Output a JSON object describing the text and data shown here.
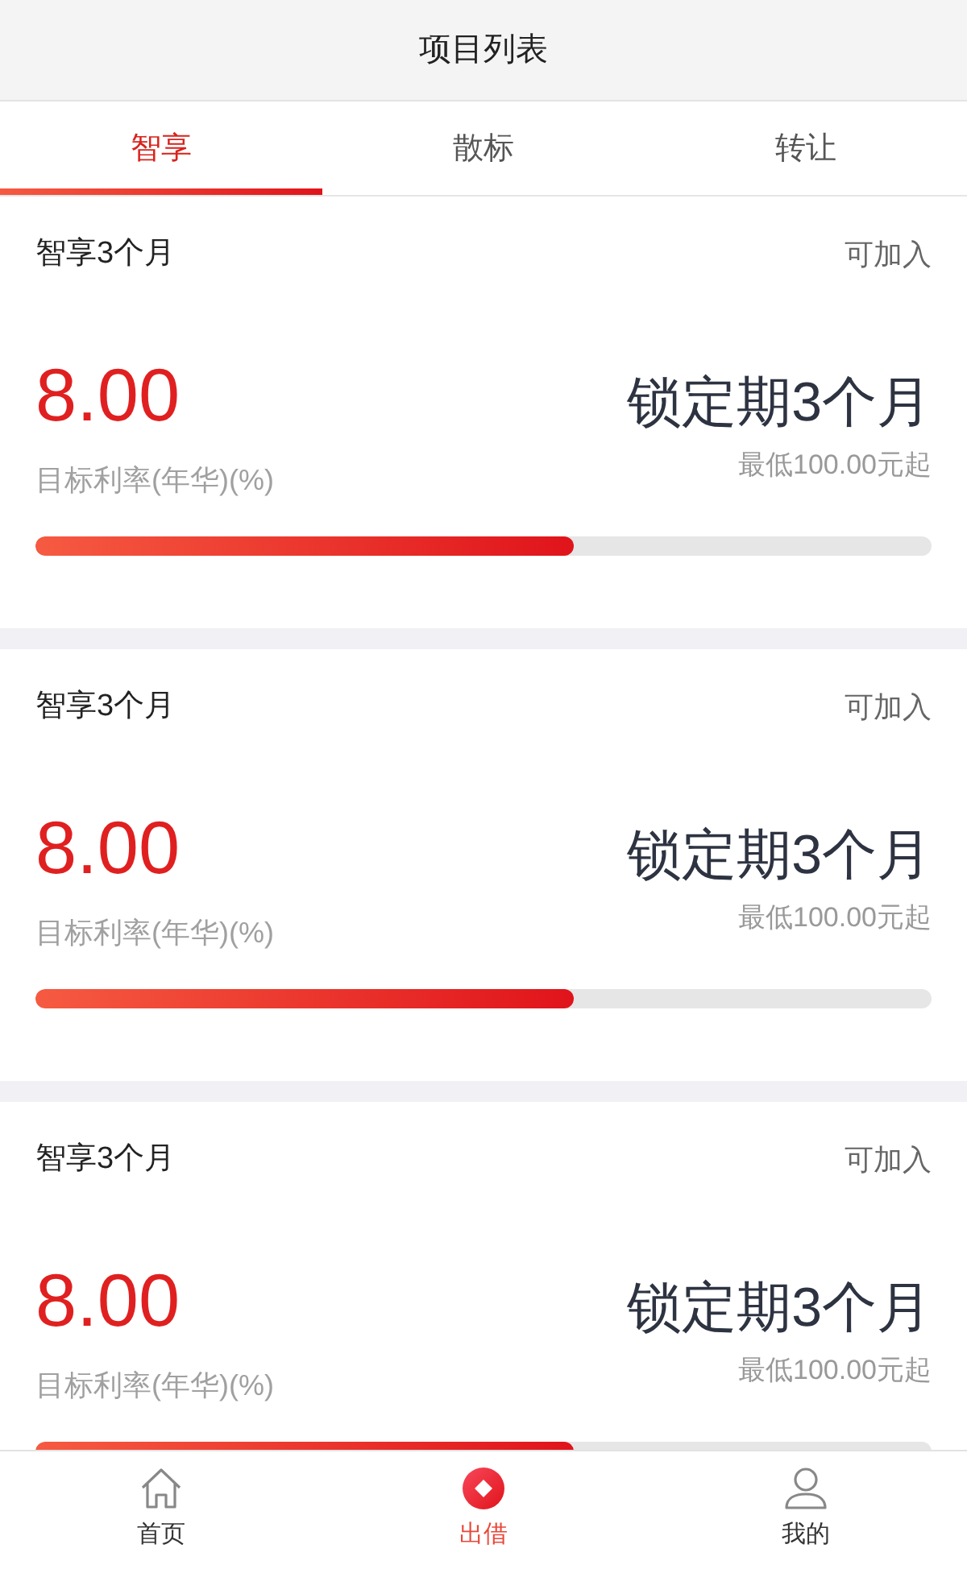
{
  "header": {
    "title": "项目列表"
  },
  "tabs": [
    {
      "label": "智享",
      "selected": true
    },
    {
      "label": "散标",
      "selected": false
    },
    {
      "label": "转让",
      "selected": false
    }
  ],
  "projects": [
    {
      "name": "智享3个月",
      "status": "可加入",
      "rate": "8.00",
      "rate_label": "目标利率(年华)(%)",
      "term": "锁定期3个月",
      "minimum": "最低100.00元起",
      "level": 0.6
    },
    {
      "name": "智享3个月",
      "status": "可加入",
      "rate": "8.00",
      "rate_label": "目标利率(年华)(%)",
      "term": "锁定期3个月",
      "minimum": "最低100.00元起",
      "level": 0.6
    },
    {
      "name": "智享3个月",
      "status": "可加入",
      "rate": "8.00",
      "rate_label": "目标利率(年华)(%)",
      "term": "锁定期3个月",
      "minimum": "最低100.00元起",
      "level": 0.6
    }
  ],
  "bottom_nav": [
    {
      "label": "首页",
      "kind": "home",
      "selected": false
    },
    {
      "label": "出借",
      "kind": "lend",
      "selected": true
    },
    {
      "label": "我的",
      "kind": "profile",
      "selected": false
    }
  ]
}
